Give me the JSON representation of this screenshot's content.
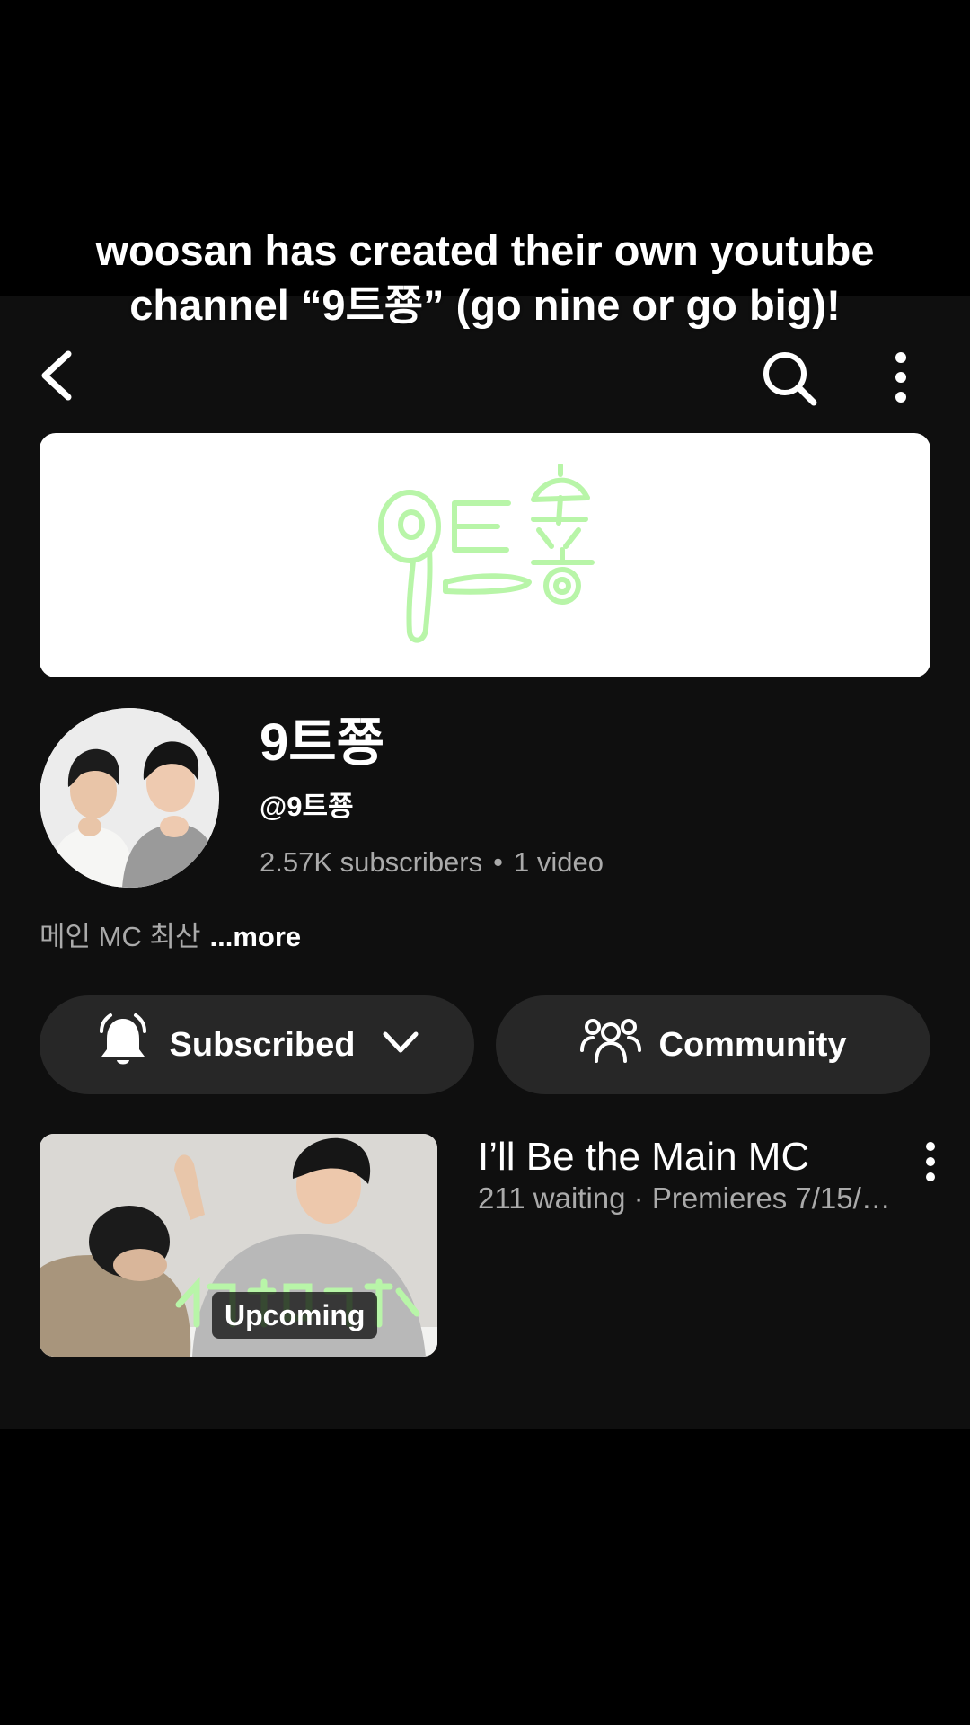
{
  "caption": {
    "line1": "woosan has created their own youtube",
    "line2": "channel “9트쭁” (go nine or go big)!"
  },
  "banner": {
    "logo_text": "9트쭁",
    "logo_color": "#b8f5a8"
  },
  "channel": {
    "name": "9트쭁",
    "handle": "@9트쭁",
    "subscribers": "2.57K subscribers",
    "separator": "•",
    "video_count": "1 video",
    "description": "메인 MC 최산",
    "more_label": "...more"
  },
  "actions": {
    "subscribed_label": "Subscribed",
    "community_label": "Community"
  },
  "video": {
    "title": "I’ll Be the Main MC",
    "meta": "211 waiting · Premieres 7/15/…",
    "badge": "Upcoming"
  },
  "icons": {
    "back": "chevron-left-icon",
    "search": "search-icon",
    "more": "more-vertical-icon",
    "bell": "bell-ringing-icon",
    "chevron": "chevron-down-icon",
    "community": "people-icon"
  },
  "colors": {
    "app_bg": "#0f0f0f",
    "pill_bg": "#272727",
    "secondary_text": "#aaaaaa"
  }
}
